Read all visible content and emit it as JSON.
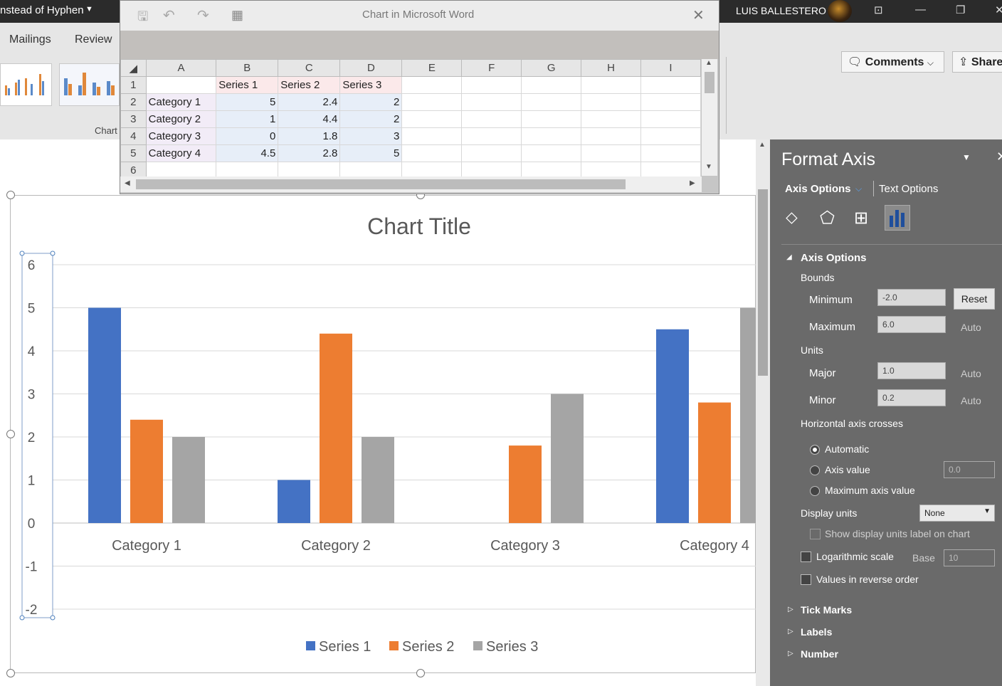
{
  "word": {
    "doc_title": "nstead of Hyphen",
    "user_name": "LUIS BALLESTERO",
    "tabs": [
      "Mailings",
      "Review"
    ],
    "comments_label": "Comments",
    "share_label": "Share",
    "chart_group_label": "Chart"
  },
  "spreadsheet": {
    "title": "Chart in Microsoft Word",
    "columns": [
      "A",
      "B",
      "C",
      "D",
      "E",
      "F",
      "G",
      "H",
      "I"
    ],
    "rows": [
      [
        "1",
        "",
        "Series 1",
        "Series 2",
        "Series 3"
      ],
      [
        "2",
        "Category 1",
        "5",
        "2.4",
        "2"
      ],
      [
        "3",
        "Category 2",
        "1",
        "4.4",
        "2"
      ],
      [
        "4",
        "Category 3",
        "0",
        "1.8",
        "3"
      ],
      [
        "5",
        "Category 4",
        "4.5",
        "2.8",
        "5"
      ],
      [
        "6",
        "",
        "",
        "",
        ""
      ]
    ]
  },
  "chart_data": {
    "type": "bar",
    "title": "Chart Title",
    "categories": [
      "Category 1",
      "Category 2",
      "Category 3",
      "Category 4"
    ],
    "series": [
      {
        "name": "Series 1",
        "color": "#4472c4",
        "values": [
          5,
          1,
          0,
          4.5
        ]
      },
      {
        "name": "Series 2",
        "color": "#ed7d31",
        "values": [
          2.4,
          4.4,
          1.8,
          2.8
        ]
      },
      {
        "name": "Series 3",
        "color": "#a5a5a5",
        "values": [
          2,
          2,
          3,
          5
        ]
      }
    ],
    "ylim": [
      -2,
      6
    ],
    "yticks": [
      "6",
      "5",
      "4",
      "3",
      "2",
      "1",
      "0",
      "-1",
      "-2"
    ],
    "grid": true,
    "legend": "bottom"
  },
  "format_pane": {
    "title": "Format Axis",
    "tab_axis": "Axis Options",
    "tab_text": "Text Options",
    "section": "Axis Options",
    "bounds_label": "Bounds",
    "minimum_label": "Minimum",
    "minimum_value": "-2.0",
    "maximum_label": "Maximum",
    "maximum_value": "6.0",
    "reset_label": "Reset",
    "auto_label": "Auto",
    "units_label": "Units",
    "major_label": "Major",
    "major_value": "1.0",
    "minor_label": "Minor",
    "minor_value": "0.2",
    "crosses_label": "Horizontal axis crosses",
    "automatic_label": "Automatic",
    "axis_value_label": "Axis value",
    "axis_value": "0.0",
    "max_axis_label": "Maximum axis value",
    "display_units_label": "Display units",
    "display_units_value": "None",
    "show_units_label": "Show display units label on chart",
    "log_label": "Logarithmic scale",
    "base_label": "Base",
    "base_value": "10",
    "reverse_label": "Values in reverse order",
    "tick_marks": "Tick Marks",
    "labels": "Labels",
    "number": "Number"
  }
}
